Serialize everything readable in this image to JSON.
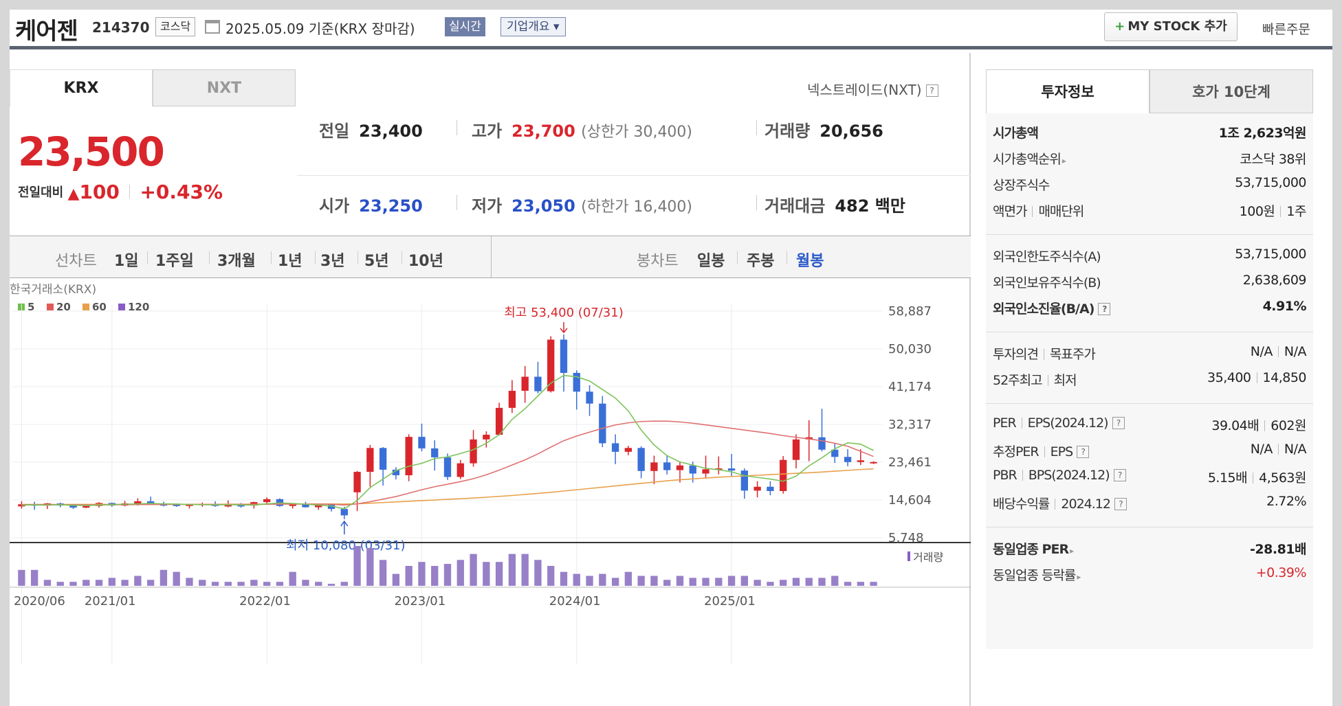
{
  "header": {
    "name": "케어젠",
    "code": "214370",
    "market": "코스닥",
    "base_date": "2025.05.09  기준(KRX 장마감)",
    "realtime": "실시간",
    "company_overview": "기업개요 ▾",
    "mystock": "MY STOCK 추가",
    "quick_order": "빠른주문"
  },
  "exchange_tabs": {
    "krx": "KRX",
    "nxt": "NXT",
    "nxt_link": "넥스트레이드(NXT)"
  },
  "quote": {
    "price": "23,500",
    "change_label": "전일대비",
    "change_arrow": "▲",
    "change_amount": "100",
    "change_pct": "+0.43%",
    "prev_label": "전일",
    "prev": "23,400",
    "high_label": "고가",
    "high": "23,700",
    "upper_limit": "(상한가 30,400)",
    "volume_label": "거래량",
    "volume": "20,656",
    "open_label": "시가",
    "open": "23,250",
    "low_label": "저가",
    "low": "23,050",
    "lower_limit": "(하한가 16,400)",
    "amount_label": "거래대금",
    "amount": "482",
    "amount_unit": "백만"
  },
  "toolbar": {
    "line_label": "선차트",
    "periods": [
      "1일",
      "1주일",
      "3개월",
      "1년",
      "3년",
      "5년",
      "10년"
    ],
    "candle_label": "봉차트",
    "candles": [
      "일봉",
      "주봉",
      "월봉"
    ],
    "active_candle": "월봉"
  },
  "chart_data": {
    "type": "candlestick",
    "source_label": "한국거래소(KRX)",
    "legend": [
      {
        "name": "5",
        "color": "#6fbf4a"
      },
      {
        "name": "20",
        "color": "#e05a5a"
      },
      {
        "name": "60",
        "color": "#e8a04a"
      },
      {
        "name": "120",
        "color": "#8a5cc8"
      }
    ],
    "y_ticks": [
      "58,887",
      "50,030",
      "41,174",
      "32,317",
      "23,461",
      "14,604",
      "5,748"
    ],
    "x_ticks": [
      "2020/06",
      "2021/01",
      "2022/01",
      "2023/01",
      "2024/01",
      "2025/01"
    ],
    "high_annotation": "최고 53,400 (07/31)",
    "low_annotation": "최저 10,080 (03/31)",
    "volume_label": "거래량",
    "candles": [
      [
        13100,
        14300,
        12600,
        13600
      ],
      [
        13600,
        14200,
        12300,
        13300
      ],
      [
        13300,
        13900,
        12500,
        13800
      ],
      [
        13800,
        14000,
        12900,
        13300
      ],
      [
        13300,
        13600,
        12500,
        12800
      ],
      [
        12800,
        13400,
        12700,
        13200
      ],
      [
        13200,
        14100,
        12800,
        13900
      ],
      [
        13900,
        14000,
        13000,
        13300
      ],
      [
        13300,
        14400,
        13100,
        13800
      ],
      [
        13800,
        15000,
        13300,
        14300
      ],
      [
        14300,
        15400,
        13500,
        13600
      ],
      [
        13600,
        14200,
        13100,
        13500
      ],
      [
        13500,
        13800,
        13000,
        13200
      ],
      [
        13200,
        13700,
        12600,
        13600
      ],
      [
        13600,
        14000,
        13000,
        13700
      ],
      [
        13700,
        14300,
        13000,
        13200
      ],
      [
        13200,
        14500,
        12900,
        13400
      ],
      [
        13400,
        13900,
        12800,
        13300
      ],
      [
        13300,
        14200,
        12600,
        14100
      ],
      [
        14100,
        15200,
        13600,
        14800
      ],
      [
        14800,
        15000,
        13000,
        13200
      ],
      [
        13200,
        13800,
        12600,
        13700
      ],
      [
        13700,
        14200,
        12800,
        12900
      ],
      [
        12900,
        13500,
        12300,
        13500
      ],
      [
        13500,
        13800,
        11900,
        12500
      ],
      [
        12500,
        13000,
        10080,
        11000
      ],
      [
        16400,
        21400,
        12000,
        21200
      ],
      [
        21200,
        27500,
        17700,
        26800
      ],
      [
        26800,
        27000,
        18000,
        21700
      ],
      [
        21700,
        22300,
        19400,
        20400
      ],
      [
        20400,
        30000,
        19000,
        29400
      ],
      [
        29400,
        32500,
        26000,
        26700
      ],
      [
        26700,
        28600,
        21500,
        24600
      ],
      [
        24600,
        25500,
        19300,
        20000
      ],
      [
        20000,
        24000,
        19500,
        23200
      ],
      [
        23200,
        31000,
        22400,
        28800
      ],
      [
        28800,
        30700,
        26900,
        29900
      ],
      [
        29900,
        37400,
        29800,
        36200
      ],
      [
        36200,
        42700,
        35000,
        40200
      ],
      [
        40200,
        46000,
        37400,
        43500
      ],
      [
        43500,
        47000,
        39600,
        40100
      ],
      [
        40100,
        53000,
        39800,
        52200
      ],
      [
        52200,
        53400,
        40000,
        44400
      ],
      [
        44400,
        45000,
        35800,
        40000
      ],
      [
        40000,
        41500,
        34300,
        37200
      ],
      [
        37200,
        39000,
        27000,
        27900
      ],
      [
        27900,
        30000,
        23000,
        25900
      ],
      [
        25900,
        27300,
        25100,
        26800
      ],
      [
        26800,
        27200,
        19700,
        21400
      ],
      [
        21400,
        25000,
        18300,
        23400
      ],
      [
        23400,
        25000,
        20600,
        21600
      ],
      [
        21600,
        23600,
        18700,
        22700
      ],
      [
        22700,
        23600,
        18700,
        20800
      ],
      [
        20800,
        25000,
        19700,
        21800
      ],
      [
        21800,
        24800,
        20600,
        22000
      ],
      [
        22000,
        25400,
        20200,
        21500
      ],
      [
        21500,
        22000,
        14900,
        16800
      ],
      [
        16800,
        19000,
        15200,
        17700
      ],
      [
        17700,
        19000,
        15700,
        16700
      ],
      [
        16700,
        24900,
        16100,
        24000
      ],
      [
        24000,
        30000,
        22000,
        28800
      ],
      [
        28800,
        33300,
        23700,
        29300
      ],
      [
        29300,
        36000,
        26000,
        26400
      ],
      [
        26400,
        28000,
        23300,
        24700
      ],
      [
        24700,
        26500,
        22500,
        23500
      ],
      [
        23500,
        26500,
        22800,
        23900
      ],
      [
        23250,
        23700,
        23050,
        23500
      ]
    ],
    "ma5": [
      13400,
      13450,
      13380,
      13500,
      13350,
      13300,
      13400,
      13500,
      13600,
      13700,
      13800,
      13700,
      13650,
      13550,
      13500,
      13450,
      13500,
      13450,
      13400,
      13700,
      13900,
      13800,
      13600,
      13400,
      13200,
      12500,
      14500,
      17500,
      19500,
      21500,
      22500,
      23200,
      24300,
      24700,
      25500,
      26400,
      27900,
      29900,
      33500,
      36000,
      39000,
      42000,
      43800,
      43500,
      42500,
      40500,
      38500,
      35500,
      31000,
      27500,
      25000,
      23500,
      22800,
      22000,
      21700,
      21200,
      20300,
      19900,
      19500,
      19000,
      20200,
      22600,
      24500,
      26600,
      28000,
      27700,
      26200
    ],
    "ma20": [
      13500,
      13520,
      13500,
      13480,
      13460,
      13450,
      13460,
      13480,
      13500,
      13520,
      13540,
      13560,
      13560,
      13560,
      13550,
      13550,
      13540,
      13540,
      13560,
      13600,
      13650,
      13650,
      13640,
      13620,
      13600,
      13400,
      13700,
      14200,
      14800,
      15400,
      16200,
      17000,
      17700,
      18300,
      18900,
      19600,
      20500,
      21600,
      22800,
      24000,
      25400,
      27000,
      28500,
      29600,
      30500,
      31400,
      32200,
      32700,
      33000,
      33100,
      33100,
      32900,
      32600,
      32200,
      31800,
      31400,
      31000,
      30600,
      30200,
      29700,
      29300,
      28900,
      28500,
      27900,
      27200,
      26000,
      24800
    ],
    "ma60": [
      13550,
      13550,
      13550,
      13550,
      13560,
      13560,
      13560,
      13570,
      13570,
      13580,
      13580,
      13590,
      13590,
      13600,
      13600,
      13600,
      13610,
      13610,
      13620,
      13630,
      13640,
      13650,
      13660,
      13670,
      13670,
      13650,
      13700,
      13850,
      14000,
      14150,
      14300,
      14450,
      14600,
      14750,
      14900,
      15050,
      15250,
      15450,
      15650,
      15900,
      16150,
      16400,
      16700,
      17000,
      17300,
      17600,
      17900,
      18200,
      18500,
      18800,
      19100,
      19350,
      19550,
      19750,
      19950,
      20100,
      20250,
      20400,
      20550,
      20700,
      20850,
      21000,
      21150,
      21350,
      21550,
      21750,
      21900
    ]
  },
  "volume_bars": [
    8,
    8,
    3,
    2,
    2,
    3,
    3,
    4,
    3,
    5,
    3,
    8,
    7,
    4,
    3,
    2,
    2,
    2,
    3,
    2,
    2,
    7,
    3,
    2,
    1,
    2,
    20,
    19,
    13,
    6,
    10,
    12,
    10,
    11,
    13,
    16,
    12,
    12,
    16,
    16,
    13,
    10,
    7,
    6,
    5,
    6,
    4,
    7,
    5,
    5,
    3,
    5,
    4,
    4,
    4,
    5,
    5,
    3,
    2,
    3,
    4,
    4,
    4,
    5,
    2,
    2,
    2
  ],
  "info_tabs": {
    "invest": "투자정보",
    "hoga": "호가 10단계"
  },
  "info": {
    "market_cap_label": "시가총액",
    "market_cap": "1조 2,623억원",
    "market_cap_rank_label": "시가총액순위",
    "market_cap_rank": "코스닥 38위",
    "shares_label": "상장주식수",
    "shares": "53,715,000",
    "par_label": "액면가",
    "lot_label": "매매단위",
    "par": "100원",
    "lot": "1주",
    "foreign_limit_label": "외국인한도주식수(A)",
    "foreign_limit": "53,715,000",
    "foreign_hold_label": "외국인보유주식수(B)",
    "foreign_hold": "2,638,609",
    "foreign_ratio_label": "외국인소진율(B/A)",
    "foreign_ratio": "4.91%",
    "opinion_label": "투자의견",
    "target_label": "목표주가",
    "opinion": "N/A",
    "target": "N/A",
    "high52_label": "52주최고",
    "low52_label": "최저",
    "high52": "35,400",
    "low52": "14,850",
    "per_label": "PER",
    "eps_label": "EPS(2024.12)",
    "per": "39.04배",
    "eps": "602원",
    "est_per_label": "추정PER",
    "est_eps_label": "EPS",
    "est_per": "N/A",
    "est_eps": "N/A",
    "pbr_label": "PBR",
    "bps_label": "BPS(2024.12)",
    "pbr": "5.15배",
    "bps": "4,563원",
    "div_label": "배당수익률",
    "div_date": "2024.12",
    "div": "2.72%",
    "ind_per_label": "동일업종 PER",
    "ind_per": "-28.81배",
    "ind_chg_label": "동일업종 등락률",
    "ind_chg": "+0.39%"
  }
}
